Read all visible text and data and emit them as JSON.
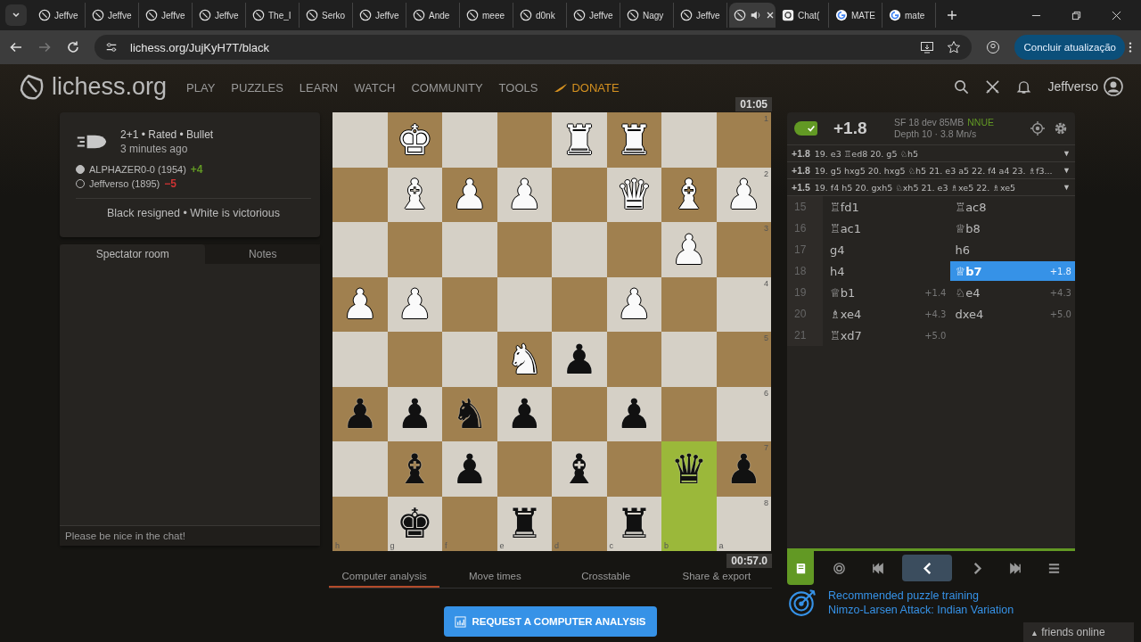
{
  "browser": {
    "tabs": [
      {
        "kind": "lichess",
        "title": "Jeffve",
        "selected": false
      },
      {
        "kind": "lichess",
        "title": "Jeffve",
        "selected": false
      },
      {
        "kind": "lichess",
        "title": "Jeffve",
        "selected": false
      },
      {
        "kind": "lichess",
        "title": "Jeffve",
        "selected": false
      },
      {
        "kind": "lichess",
        "title": "The_I",
        "selected": false
      },
      {
        "kind": "lichess",
        "title": "Serko",
        "selected": false
      },
      {
        "kind": "lichess",
        "title": "Jeffve",
        "selected": false
      },
      {
        "kind": "lichess",
        "title": "Ande",
        "selected": false
      },
      {
        "kind": "lichess",
        "title": "meee",
        "selected": false
      },
      {
        "kind": "lichess",
        "title": "d0nk",
        "selected": false
      },
      {
        "kind": "lichess",
        "title": "Jeffve",
        "selected": false
      },
      {
        "kind": "lichess",
        "title": "Nagy",
        "selected": false
      },
      {
        "kind": "lichess",
        "title": "Jeffve",
        "selected": false
      },
      {
        "kind": "lichess",
        "selected": true,
        "audio": true
      },
      {
        "kind": "chat",
        "title": "Chat(",
        "selected": false
      },
      {
        "kind": "google",
        "title": "MATE",
        "selected": false
      },
      {
        "kind": "google",
        "title": "mate",
        "selected": false
      }
    ],
    "url": "lichess.org/JujKyH7T/black",
    "update_button": "Concluir atualização"
  },
  "site": {
    "logo": "lichess.org",
    "nav": [
      {
        "label": "PLAY",
        "kind": "link"
      },
      {
        "label": "PUZZLES",
        "kind": "link"
      },
      {
        "label": "LEARN",
        "kind": "link"
      },
      {
        "label": "WATCH",
        "kind": "link"
      },
      {
        "label": "COMMUNITY",
        "kind": "link"
      },
      {
        "label": "TOOLS",
        "kind": "link"
      },
      {
        "label": "DONATE",
        "kind": "donate"
      }
    ],
    "user": "Jeffverso"
  },
  "game": {
    "setup": "2+1 • Rated • Bullet",
    "time": "3 minutes ago",
    "players": [
      {
        "kind": "filled",
        "name": "ALPHAZER0-0 (1954)",
        "diff": "+4",
        "color": "#629924"
      },
      {
        "kind": "hollow",
        "name": "Jeffverso (1895)",
        "diff": "−5",
        "color": "#cc3333"
      }
    ],
    "status": "Black resigned • White is victorious"
  },
  "chat": {
    "tabs": [
      {
        "label": "Spectator room",
        "selected": true
      },
      {
        "label": "Notes",
        "selected": false
      }
    ],
    "placeholder": "Please be nice in the chat!"
  },
  "board": {
    "ranks": [
      "1",
      "2",
      "3",
      "4",
      "5",
      "6",
      "7",
      "8"
    ],
    "files": [
      "h",
      "g",
      "f",
      "e",
      "d",
      "c",
      "b",
      "a"
    ],
    "top_clock": "01:05",
    "bottom_clock": "00:57.0",
    "rows": [
      [
        {
          "highlight": false
        },
        {
          "piece": "♚",
          "kind": "white",
          "highlight": false
        },
        {
          "highlight": false
        },
        {
          "highlight": false
        },
        {
          "piece": "♜",
          "kind": "white",
          "highlight": false
        },
        {
          "piece": "♜",
          "kind": "white",
          "highlight": false
        },
        {
          "highlight": false
        },
        {
          "highlight": false
        }
      ],
      [
        {
          "highlight": false
        },
        {
          "piece": "♝",
          "kind": "white",
          "highlight": false
        },
        {
          "piece": "♟",
          "kind": "white",
          "highlight": false
        },
        {
          "piece": "♟",
          "kind": "white",
          "highlight": false
        },
        {
          "highlight": false
        },
        {
          "piece": "♛",
          "kind": "white",
          "highlight": false
        },
        {
          "piece": "♝",
          "kind": "white",
          "highlight": false
        },
        {
          "piece": "♟",
          "kind": "white",
          "highlight": false
        }
      ],
      [
        {
          "highlight": false
        },
        {
          "highlight": false
        },
        {
          "highlight": false
        },
        {
          "highlight": false
        },
        {
          "highlight": false
        },
        {
          "highlight": false
        },
        {
          "piece": "♟",
          "kind": "white",
          "highlight": false
        },
        {
          "highlight": false
        }
      ],
      [
        {
          "piece": "♟",
          "kind": "white",
          "highlight": false
        },
        {
          "piece": "♟",
          "kind": "white",
          "highlight": false
        },
        {
          "highlight": false
        },
        {
          "highlight": false
        },
        {
          "highlight": false
        },
        {
          "piece": "♟",
          "kind": "white",
          "highlight": false
        },
        {
          "highlight": false
        },
        {
          "highlight": false
        }
      ],
      [
        {
          "highlight": false
        },
        {
          "highlight": false
        },
        {
          "highlight": false
        },
        {
          "piece": "♞",
          "kind": "white",
          "highlight": false
        },
        {
          "piece": "♟",
          "kind": "black",
          "highlight": false
        },
        {
          "highlight": false
        },
        {
          "highlight": false
        },
        {
          "highlight": false
        }
      ],
      [
        {
          "piece": "♟",
          "kind": "black",
          "highlight": false
        },
        {
          "piece": "♟",
          "kind": "black",
          "highlight": false
        },
        {
          "piece": "♞",
          "kind": "black",
          "highlight": false
        },
        {
          "piece": "♟",
          "kind": "black",
          "highlight": false
        },
        {
          "highlight": false
        },
        {
          "piece": "♟",
          "kind": "black",
          "highlight": false
        },
        {
          "highlight": false
        },
        {
          "highlight": false
        }
      ],
      [
        {
          "highlight": false
        },
        {
          "piece": "♝",
          "kind": "black",
          "highlight": false
        },
        {
          "piece": "♟",
          "kind": "black",
          "highlight": false
        },
        {
          "highlight": false
        },
        {
          "piece": "♝",
          "kind": "black",
          "highlight": false
        },
        {
          "highlight": false
        },
        {
          "piece": "♛",
          "kind": "black",
          "highlight": true
        },
        {
          "piece": "♟",
          "kind": "black",
          "highlight": false
        }
      ],
      [
        {
          "highlight": false
        },
        {
          "piece": "♚",
          "kind": "black",
          "highlight": false
        },
        {
          "highlight": false
        },
        {
          "piece": "♜",
          "kind": "black",
          "highlight": false
        },
        {
          "highlight": false
        },
        {
          "piece": "♜",
          "kind": "black",
          "highlight": false
        },
        {
          "highlight": true
        },
        {
          "highlight": false
        }
      ]
    ]
  },
  "board_tabs": [
    {
      "label": "Computer analysis",
      "selected": true
    },
    {
      "label": "Move times",
      "selected": false
    },
    {
      "label": "Crosstable",
      "selected": false
    },
    {
      "label": "Share & export",
      "selected": false
    }
  ],
  "analysis_button": "REQUEST A COMPUTER ANALYSIS",
  "engine": {
    "on": true,
    "eval": "+1.8",
    "name": "SF 18 dev 85MB",
    "nnue": "NNUE",
    "depth": "Depth 10 · 3.8 Mn/s",
    "lines": [
      {
        "eval": "+1.8",
        "moves": "19. e3 ♖ed8 20. g5 ♘h5",
        "arrow": "▼"
      },
      {
        "eval": "+1.8",
        "moves": "19. g5 hxg5 20. hxg5 ♘h5 21. e3 a5 22. f4 a4 23. ♗f3...",
        "arrow": "▼"
      },
      {
        "eval": "+1.5",
        "moves": "19. f4 h5 20. gxh5 ♘xh5 21. e3 ♗xe5 22. ♗xe5",
        "arrow": "▼"
      }
    ]
  },
  "moves": [
    {
      "index": "15",
      "white": {
        "san": "♖fd1",
        "selected": false
      },
      "black": {
        "san": "♖ac8",
        "selected": false
      }
    },
    {
      "index": "16",
      "white": {
        "san": "♖ac1",
        "selected": false
      },
      "black": {
        "san": "♕b8",
        "selected": false
      }
    },
    {
      "index": "17",
      "white": {
        "san": "g4",
        "selected": false
      },
      "black": {
        "san": "h6",
        "selected": false
      }
    },
    {
      "index": "18",
      "white": {
        "san": "h4",
        "selected": false
      },
      "black": {
        "san": "♕b7",
        "eval": "+1.8",
        "selected": true
      }
    },
    {
      "index": "19",
      "white": {
        "san": "♕b1",
        "eval": "+1.4",
        "selected": false
      },
      "black": {
        "san": "♘e4",
        "eval": "+4.3",
        "selected": false
      }
    },
    {
      "index": "20",
      "white": {
        "san": "♗xe4",
        "eval": "+4.3",
        "selected": false
      },
      "black": {
        "san": "dxe4",
        "eval": "+5.0",
        "selected": false
      }
    },
    {
      "index": "21",
      "white": {
        "san": "♖xd7",
        "eval": "+5.0",
        "selected": false
      }
    }
  ],
  "controls": [
    {
      "kind": "book",
      "selected": true
    },
    {
      "kind": "target",
      "selected": false
    },
    {
      "kind": "first",
      "selected": false
    },
    {
      "kind": "prev",
      "selected": false,
      "hovered": true
    },
    {
      "kind": "next",
      "selected": false
    },
    {
      "kind": "last",
      "selected": false
    },
    {
      "kind": "menu",
      "selected": false
    }
  ],
  "puzzle": {
    "title": "Recommended puzzle training",
    "theme": "Nimzo-Larsen Attack: Indian Variation"
  },
  "friends": {
    "arrow": "▲",
    "label": "friends online"
  }
}
